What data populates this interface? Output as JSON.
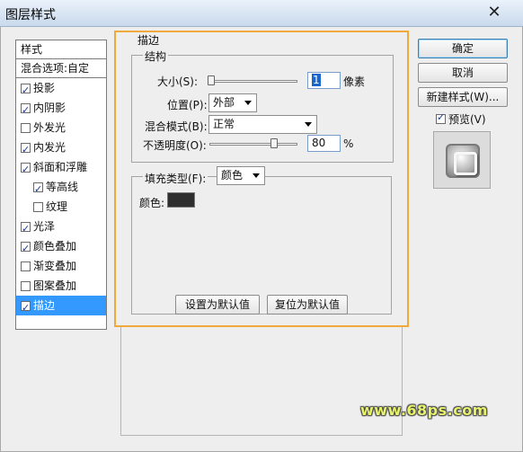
{
  "window": {
    "title": "图层样式",
    "close_glyph": "✕"
  },
  "sidebar": {
    "header": "样式",
    "blending": "混合选项:自定",
    "items": [
      {
        "label": "投影",
        "checked": true,
        "sub": false,
        "selected": false
      },
      {
        "label": "内阴影",
        "checked": true,
        "sub": false,
        "selected": false
      },
      {
        "label": "外发光",
        "checked": false,
        "sub": false,
        "selected": false
      },
      {
        "label": "内发光",
        "checked": true,
        "sub": false,
        "selected": false
      },
      {
        "label": "斜面和浮雕",
        "checked": true,
        "sub": false,
        "selected": false
      },
      {
        "label": "等高线",
        "checked": true,
        "sub": true,
        "selected": false
      },
      {
        "label": "纹理",
        "checked": false,
        "sub": true,
        "selected": false
      },
      {
        "label": "光泽",
        "checked": true,
        "sub": false,
        "selected": false
      },
      {
        "label": "颜色叠加",
        "checked": true,
        "sub": false,
        "selected": false
      },
      {
        "label": "渐变叠加",
        "checked": false,
        "sub": false,
        "selected": false
      },
      {
        "label": "图案叠加",
        "checked": false,
        "sub": false,
        "selected": false
      },
      {
        "label": "描边",
        "checked": true,
        "sub": false,
        "selected": true
      }
    ]
  },
  "stroke": {
    "section_title": "描边",
    "structure": {
      "title": "结构",
      "size_label": "大小(S):",
      "size_value": "1",
      "size_unit": "像素",
      "size_fraction": 0.0,
      "position_label": "位置(P):",
      "position_value": "外部",
      "blend_label": "混合模式(B):",
      "blend_value": "正常",
      "opacity_label": "不透明度(O):",
      "opacity_value": "80",
      "opacity_unit": "%",
      "opacity_fraction": 0.8
    },
    "fill": {
      "type_label": "填充类型(F):",
      "type_value": "颜色",
      "color_label": "颜色:",
      "color": "#2e2e2e"
    },
    "default_buttons": {
      "make_default": "设置为默认值",
      "reset_default": "复位为默认值"
    }
  },
  "buttons": {
    "ok": "确定",
    "cancel": "取消",
    "new_style": "新建样式(W)...",
    "preview_label": "预览(V)",
    "preview_checked": true
  },
  "watermark": "www.68ps.com",
  "colors": {
    "highlight": "#f0a93c",
    "selection": "#3399ff",
    "watermark": "#e7f36b"
  }
}
